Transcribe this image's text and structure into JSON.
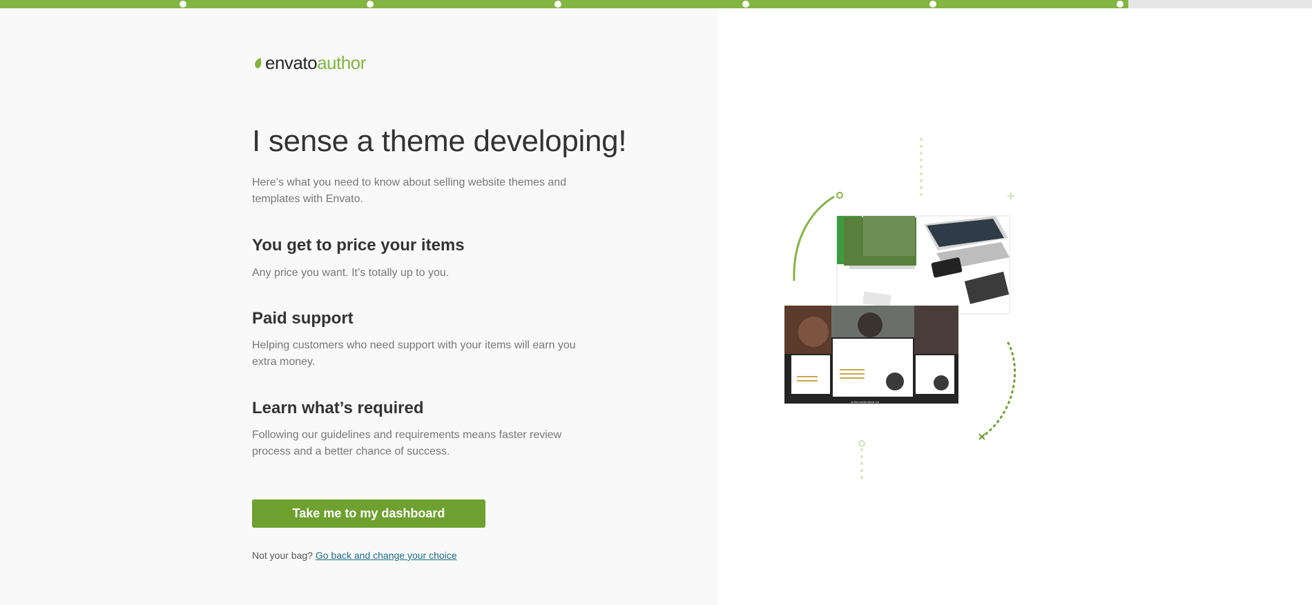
{
  "progress": {
    "completed_fraction": 0.86,
    "steps": 7
  },
  "brand": {
    "name_part1": "envato",
    "name_part2": "author",
    "accent_color": "#82b541"
  },
  "main": {
    "headline": "I sense a theme developing!",
    "intro": "Here’s what you need to know about selling website themes and templates with Envato.",
    "sections": [
      {
        "title": "You get to price your items",
        "body": "Any price you want. It’s totally up to you."
      },
      {
        "title": "Paid support",
        "body": "Helping customers who need support with your items will earn you extra money."
      },
      {
        "title": "Learn what’s required",
        "body": "Following our guidelines and requirements means faster review process and a better chance of success."
      }
    ],
    "cta_label": "Take me to my dashboard",
    "footer_text": "Not your bag?",
    "footer_link": "Go back and change your choice"
  },
  "illustration": {
    "icon": "website-themes-devices-illustration",
    "snippet": "ck few words about our"
  }
}
